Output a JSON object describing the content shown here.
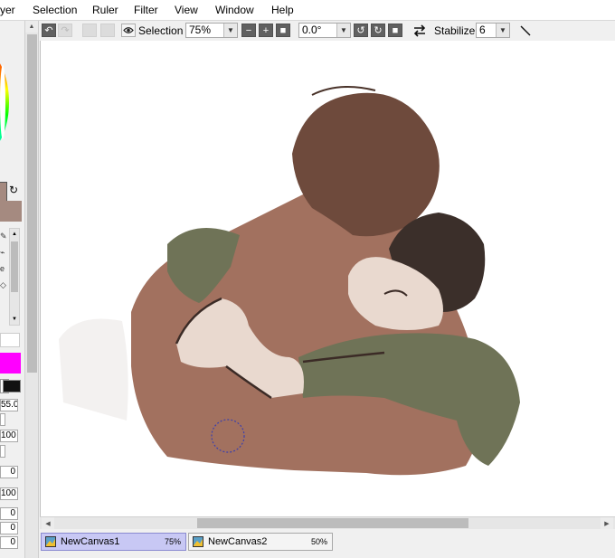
{
  "menu": {
    "items": [
      "yer",
      "Selection",
      "Ruler",
      "Filter",
      "View",
      "Window",
      "Help"
    ]
  },
  "toolbar": {
    "selection_label": "Selection",
    "zoom_value": "75%",
    "rotation_value": "0.0°",
    "stabilizer_label": "Stabilizer",
    "stabilizer_value": "6"
  },
  "left_panel": {
    "fields": [
      "55.0",
      "100",
      "0",
      "100",
      "0",
      "0",
      "0"
    ],
    "colors": {
      "magenta": "#ff00ff",
      "swatch": "#a58a80",
      "wheel_green": "#1de87a"
    }
  },
  "canvas_tabs": [
    {
      "name": "NewCanvas1",
      "zoom": "75%",
      "active": true
    },
    {
      "name": "NewCanvas2",
      "zoom": "50%",
      "active": false
    }
  ],
  "colors": {
    "skin_dark": "#a2715f",
    "skin_light": "#e9d9cf",
    "hair": "#6e4a3c",
    "sleeve": "#6f7357",
    "outline": "#3b2b26"
  }
}
